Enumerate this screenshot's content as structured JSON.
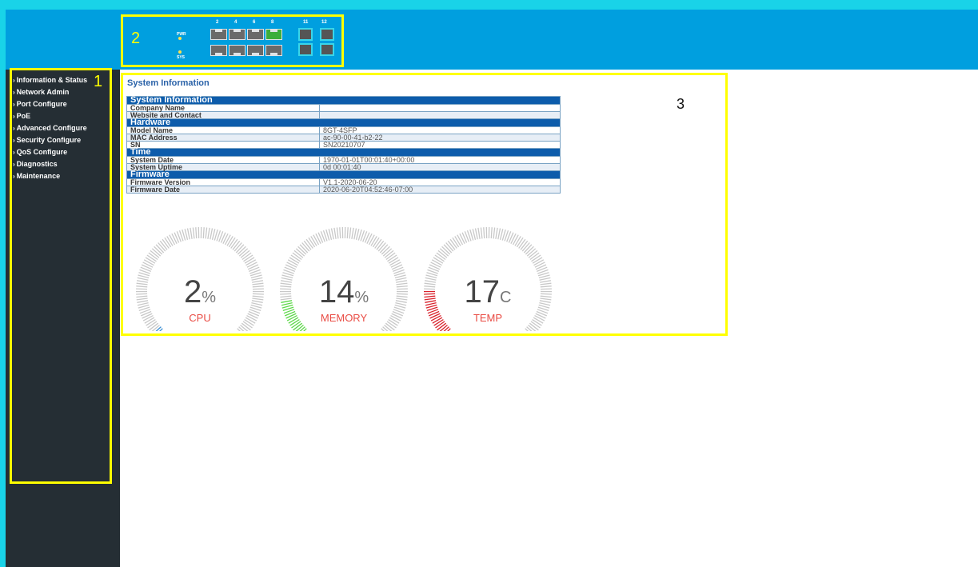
{
  "annotations": {
    "sidebar": "1",
    "header": "2",
    "content": "3"
  },
  "menu": [
    "Information & Status",
    "Network Admin",
    "Port Configure",
    "PoE",
    "Advanced Configure",
    "Security Configure",
    "QoS Configure",
    "Diagnostics",
    "Maintenance"
  ],
  "panel": {
    "leds": {
      "pwr": "PWR",
      "sys": "SYS"
    },
    "port_numbers_top": [
      "2",
      "4",
      "6",
      "8",
      "11",
      "12"
    ],
    "active_port": "8"
  },
  "page_title": "System Information",
  "sections": [
    {
      "title": "System Information",
      "rows": [
        {
          "label": "Company Name",
          "value": ""
        },
        {
          "label": "Website and Contact",
          "value": ""
        }
      ]
    },
    {
      "title": "Hardware",
      "rows": [
        {
          "label": "Model Name",
          "value": "8GT-4SFP"
        },
        {
          "label": "MAC Address",
          "value": "ac-90-00-41-b2-22"
        },
        {
          "label": "SN",
          "value": "SN20210707"
        }
      ]
    },
    {
      "title": "Time",
      "rows": [
        {
          "label": "System Date",
          "value": "1970-01-01T00:01:40+00:00"
        },
        {
          "label": "System Uptime",
          "value": "0d 00:01:40"
        }
      ]
    },
    {
      "title": "Firmware",
      "rows": [
        {
          "label": "Firmware Version",
          "value": "V1.1-2020-06-20"
        },
        {
          "label": "Firmware Date",
          "value": "2020-06-20T04:52:46-07:00"
        }
      ]
    }
  ],
  "gauges": [
    {
      "value": 2,
      "unit": "%",
      "label": "CPU",
      "color": "#3b8fd4",
      "fraction": 0.02
    },
    {
      "value": 14,
      "unit": "%",
      "label": "MEMORY",
      "color": "#5ed84a",
      "fraction": 0.14
    },
    {
      "value": 17,
      "unit": "C",
      "label": "TEMP",
      "color": "#d9232d",
      "fraction": 0.17
    }
  ],
  "colors": {
    "header": "#009fdf",
    "sidebar": "#252e34",
    "frame": "#19d3e8",
    "highlight": "#ffff00",
    "section_bar": "#0d5cab",
    "gauge_track": "#c8c8c8",
    "gauge_label": "#e94b43"
  }
}
